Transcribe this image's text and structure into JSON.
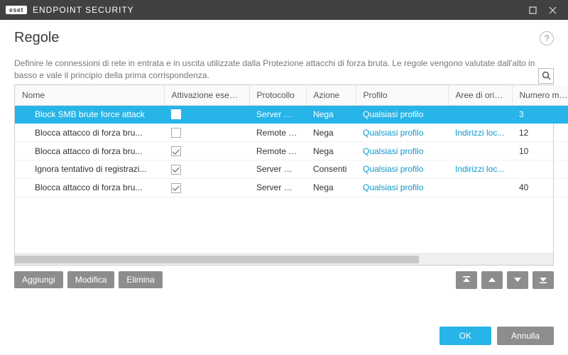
{
  "titlebar": {
    "brand_badge": "eset",
    "brand_text": "ENDPOINT SECURITY"
  },
  "header": {
    "title": "Regole",
    "help_label": "?"
  },
  "description": "Definire le connessioni di rete in entrata e in uscita utilizzate dalla Protezione attacchi di forza bruta. Le regole vengono valutate dall'alto in basso e vale il principio della prima corrispondenza.",
  "columns": {
    "nome": "Nome",
    "attivazione": "Attivazione eseguita",
    "protocollo": "Protocollo",
    "azione": "Azione",
    "profilo": "Profilo",
    "aree": "Aree di origine",
    "numero": "Numero massi..."
  },
  "rows": [
    {
      "nome": "Block SMB brute force attack",
      "attivazione": false,
      "protocollo": "Server Mes...",
      "azione": "Nega",
      "profilo": "Qualsiasi profilo",
      "aree": "",
      "numero": "3",
      "selected": true
    },
    {
      "nome": "Blocca attacco di forza bru...",
      "attivazione": false,
      "protocollo": "Remote D...",
      "azione": "Nega",
      "profilo": "Qualsiasi profilo",
      "aree": "Indirizzi loc...",
      "numero": "12",
      "selected": false
    },
    {
      "nome": "Blocca attacco di forza bru...",
      "attivazione": true,
      "protocollo": "Remote D...",
      "azione": "Nega",
      "profilo": "Qualsiasi profilo",
      "aree": "",
      "numero": "10",
      "selected": false
    },
    {
      "nome": "Ignora tentativo di registrazi...",
      "attivazione": true,
      "protocollo": "Server Mes...",
      "azione": "Consenti",
      "profilo": "Qualsiasi profilo",
      "aree": "Indirizzi loc...",
      "numero": "",
      "selected": false
    },
    {
      "nome": "Blocca attacco di forza bru...",
      "attivazione": true,
      "protocollo": "Server Mes...",
      "azione": "Nega",
      "profilo": "Qualsiasi profilo",
      "aree": "",
      "numero": "40",
      "selected": false
    }
  ],
  "actions": {
    "add": "Aggiungi",
    "edit": "Modifica",
    "delete": "Elimina"
  },
  "footer": {
    "ok": "OK",
    "cancel": "Annulla"
  }
}
